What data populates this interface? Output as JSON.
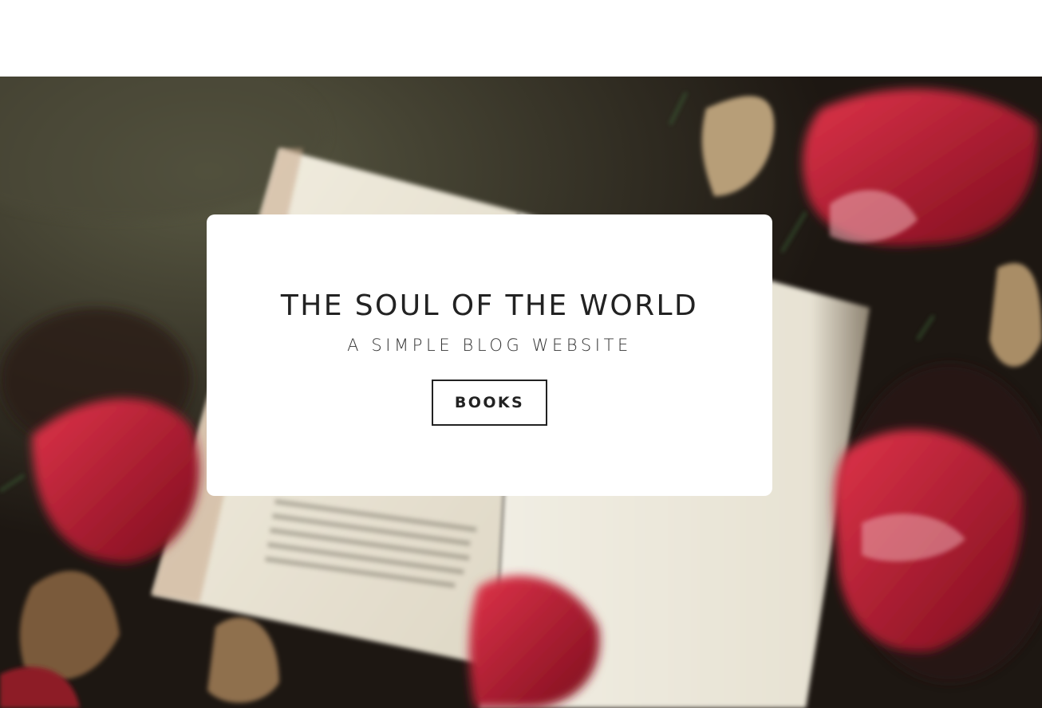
{
  "hero": {
    "title": "THE SOUL OF THE WORLD",
    "subtitle": "A SIMPLE BLOG WEBSITE",
    "button_label": "BOOKS",
    "background_image": "open-book-with-red-autumn-leaves"
  },
  "colors": {
    "card_background": "#ffffff",
    "text": "#222222",
    "leaf_red": "#b3122a",
    "page_cream": "#ece7da",
    "ground_dark": "#1d1712"
  }
}
